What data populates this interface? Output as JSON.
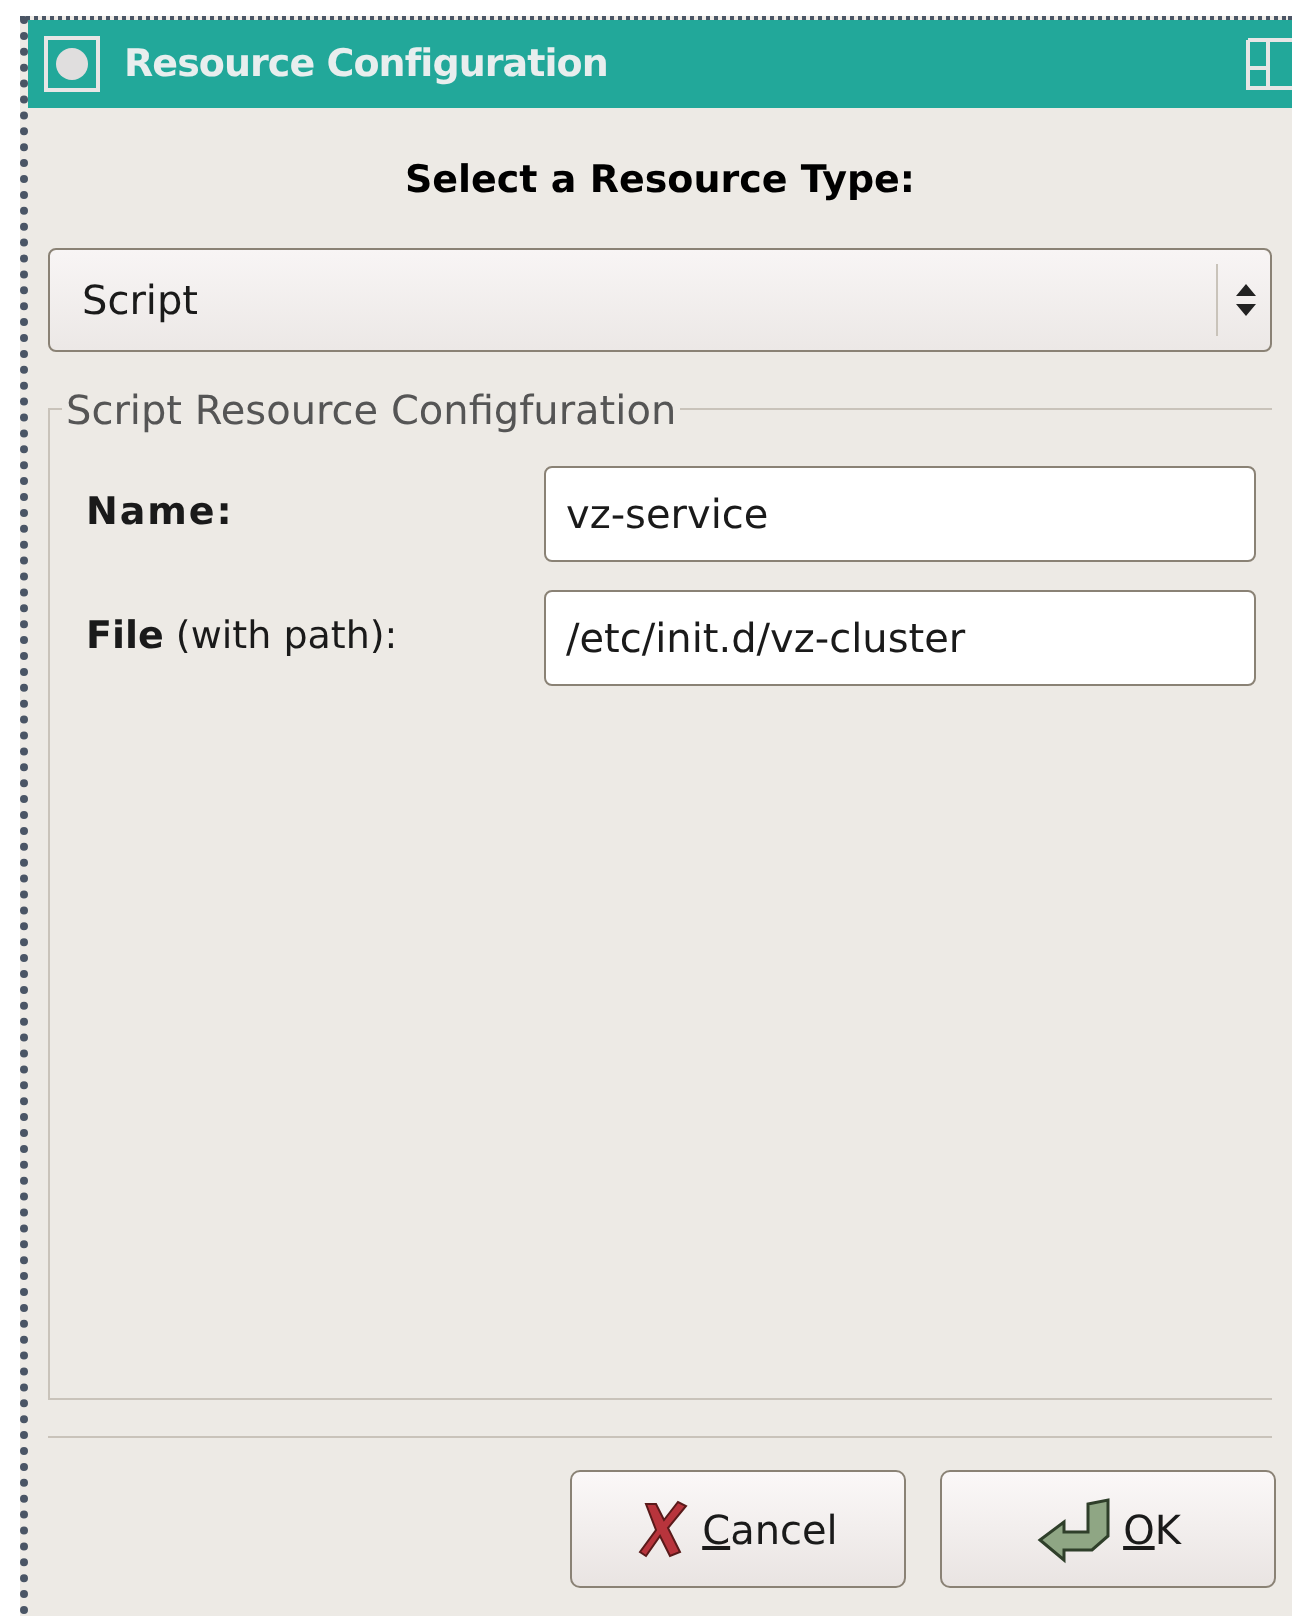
{
  "window": {
    "title": "Resource Configuration"
  },
  "heading": "Select a Resource Type:",
  "resource_type": {
    "value": "Script"
  },
  "group": {
    "title": "Script Resource Configfuration",
    "fields": [
      {
        "label": "Name:",
        "value": "vz-service"
      },
      {
        "label": "**File** (with path):",
        "value": "/etc/init.d/vz-cluster"
      }
    ]
  },
  "buttons": [
    {
      "label": "Cancel",
      "kind": "cancel",
      "mnemonic_underlined": true
    },
    {
      "label": "OK",
      "kind": "ok",
      "mnemonic_underlined": true
    }
  ]
}
